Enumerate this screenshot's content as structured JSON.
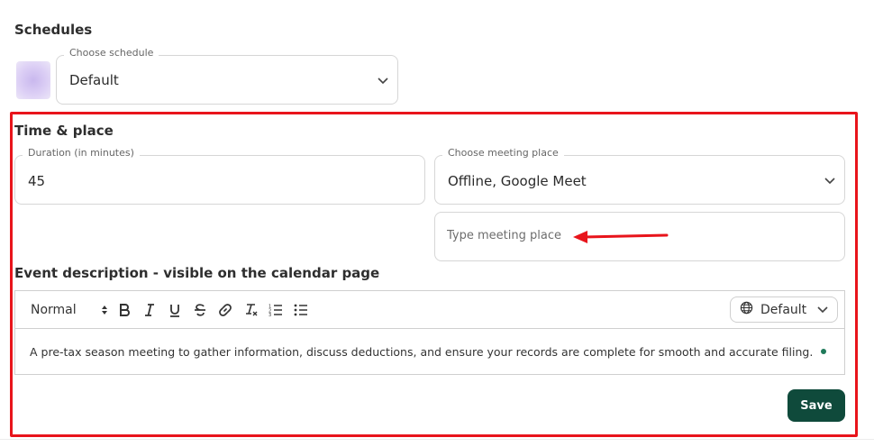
{
  "schedules": {
    "title": "Schedules",
    "legend": "Choose schedule",
    "value": "Default"
  },
  "time_place": {
    "title": "Time & place",
    "duration_legend": "Duration (in minutes)",
    "duration_value": "45",
    "place_legend": "Choose meeting place",
    "place_value": "Offline, Google Meet",
    "place_placeholder": "Type meeting place"
  },
  "description": {
    "title": "Event description - visible on the calendar page",
    "format": "Normal",
    "language": "Default",
    "text": "A pre-tax season meeting to gather information, discuss deductions, and ensure your records are complete for smooth and accurate filing."
  },
  "actions": {
    "save_label": "Save"
  },
  "colors": {
    "highlight": "#e8141b",
    "primary": "#0f4a3b"
  }
}
